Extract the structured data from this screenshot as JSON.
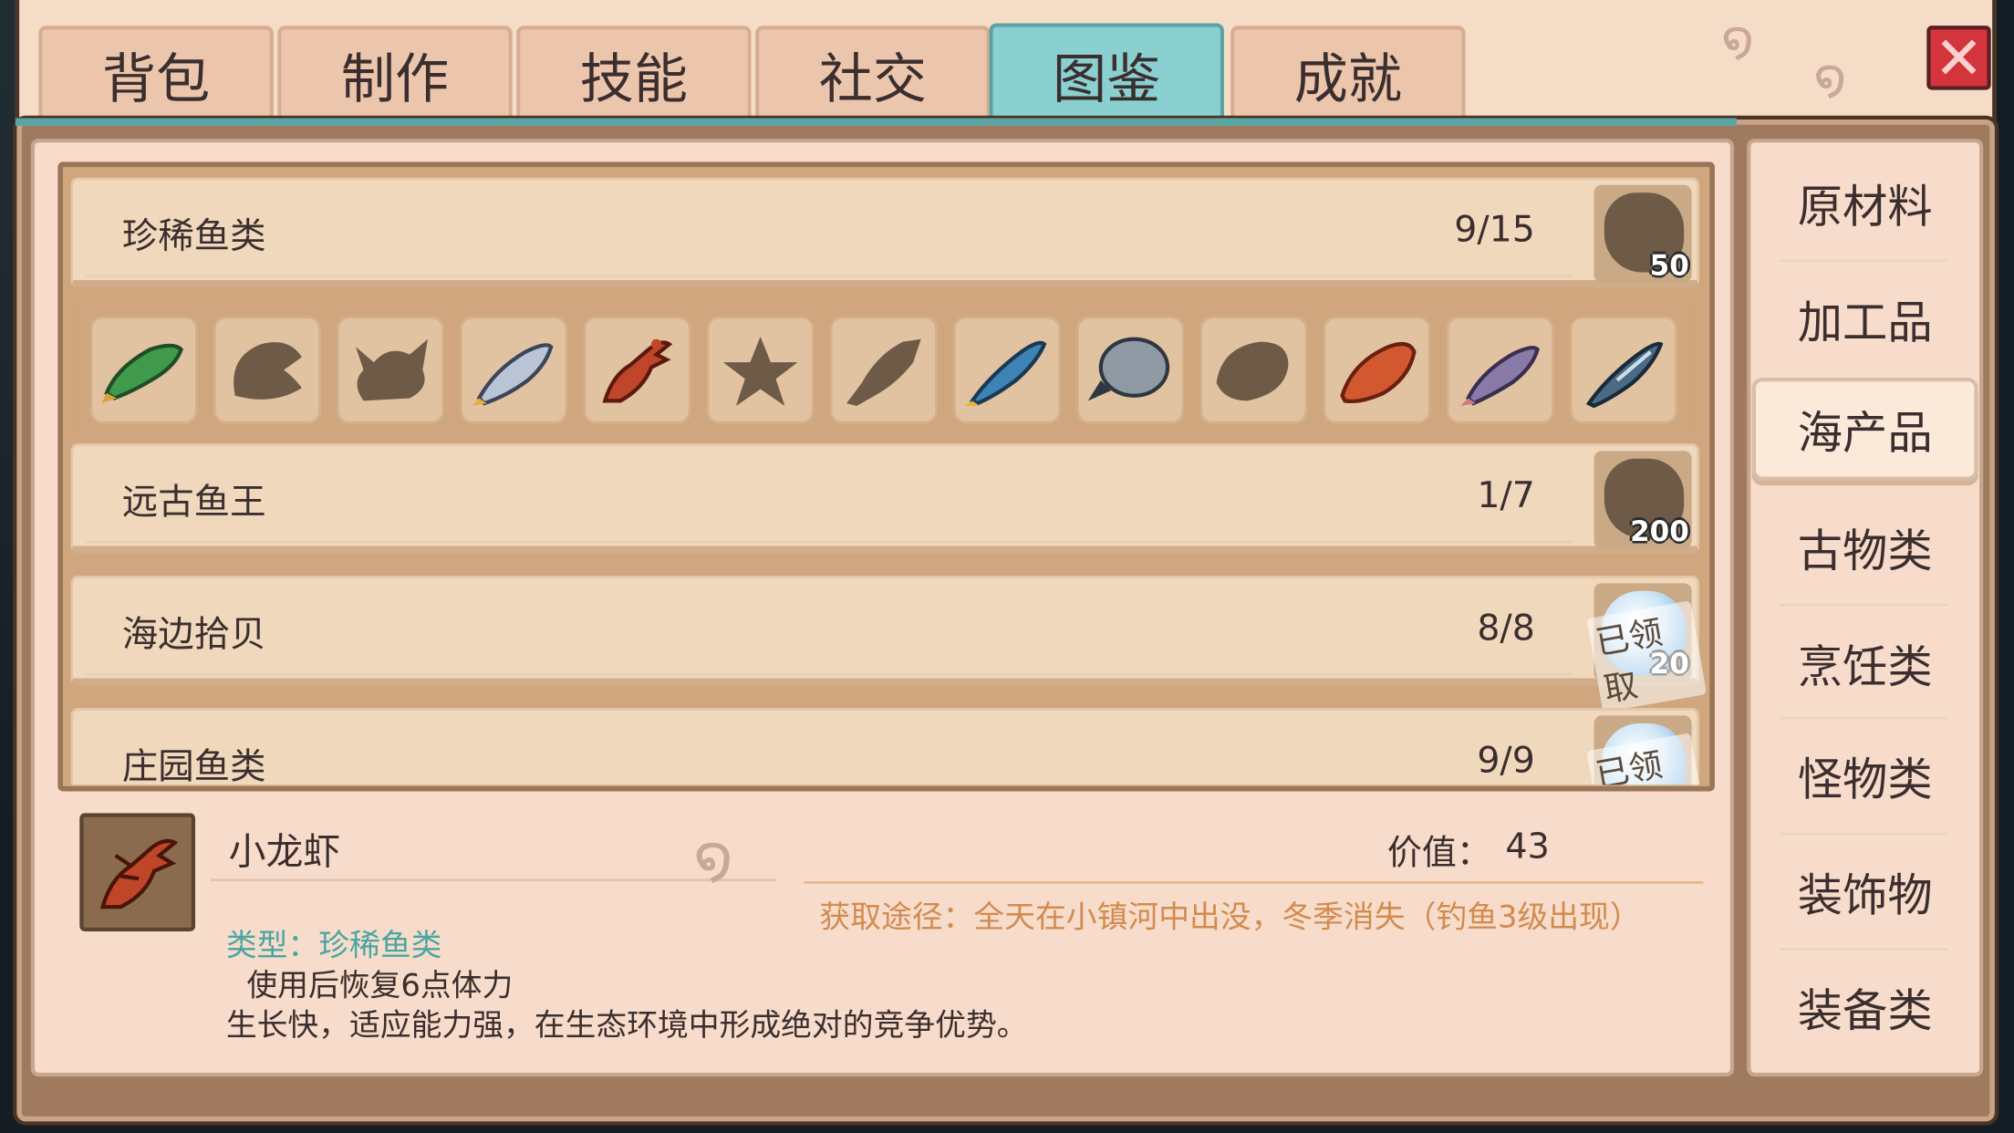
{
  "tabs": [
    {
      "label": "背包",
      "active": false
    },
    {
      "label": "制作",
      "active": false
    },
    {
      "label": "技能",
      "active": false
    },
    {
      "label": "社交",
      "active": false
    },
    {
      "label": "图鉴",
      "active": true
    },
    {
      "label": "成就",
      "active": false
    }
  ],
  "close_label": "✕",
  "sidebar": [
    {
      "label": "原材料",
      "active": false
    },
    {
      "label": "加工品",
      "active": false
    },
    {
      "label": "海产品",
      "active": true
    },
    {
      "label": "古物类",
      "active": false
    },
    {
      "label": "烹饪类",
      "active": false
    },
    {
      "label": "怪物类",
      "active": false
    },
    {
      "label": "装饰物",
      "active": false
    },
    {
      "label": "装备类",
      "active": false
    }
  ],
  "collections": [
    {
      "title": "珍稀鱼类",
      "count": "9/15",
      "reward": "50",
      "claimed": false,
      "claimed_label": ""
    },
    {
      "title": "远古鱼王",
      "count": "1/7",
      "reward": "200",
      "claimed": false,
      "claimed_label": ""
    },
    {
      "title": "海边拾贝",
      "count": "8/8",
      "reward": "20",
      "claimed": true,
      "claimed_label": "已领取"
    },
    {
      "title": "庄园鱼类",
      "count": "9/9",
      "reward": "",
      "claimed": true,
      "claimed_label": "已领取"
    }
  ],
  "fish_icons": [
    {
      "icon": "green-fish-icon",
      "discovered": true,
      "color": "#3f9a4c"
    },
    {
      "icon": "unknown-silhouette-icon",
      "discovered": false,
      "color": "#6e5b47"
    },
    {
      "icon": "unknown-silhouette-icon",
      "discovered": false,
      "color": "#6e5b47"
    },
    {
      "icon": "silver-fish-icon",
      "discovered": true,
      "color": "#9fb0c8"
    },
    {
      "icon": "crayfish-icon",
      "discovered": true,
      "color": "#c0462a"
    },
    {
      "icon": "unknown-silhouette-icon",
      "discovered": false,
      "color": "#6e5b47"
    },
    {
      "icon": "unknown-silhouette-icon",
      "discovered": false,
      "color": "#6e5b47"
    },
    {
      "icon": "blue-fish-icon",
      "discovered": true,
      "color": "#3d83b6"
    },
    {
      "icon": "grey-round-fish-icon",
      "discovered": true,
      "color": "#8f9aa5"
    },
    {
      "icon": "unknown-silhouette-icon",
      "discovered": false,
      "color": "#6e5b47"
    },
    {
      "icon": "red-fish-icon",
      "discovered": true,
      "color": "#d2582f"
    },
    {
      "icon": "purple-fish-icon",
      "discovered": true,
      "color": "#8a7aa8"
    },
    {
      "icon": "tuna-icon",
      "discovered": true,
      "color": "#4a6a86"
    }
  ],
  "detail": {
    "name": "小龙虾",
    "value_label": "价值：",
    "value": "43",
    "source_label": "获取途径：全天在小镇河中出没，冬季消失（钓鱼3级出现）",
    "type_label": "类型：珍稀鱼类",
    "effect": "使用后恢复6点体力",
    "description": "生长快，适应能力强，在生态环境中形成绝对的竞争优势。"
  },
  "colors": {
    "accent_teal": "#8ad0d0",
    "panel": "#f7dccb",
    "close_red": "#d4343c",
    "type_text": "#4aa6a2",
    "source_text": "#d28b4e"
  }
}
